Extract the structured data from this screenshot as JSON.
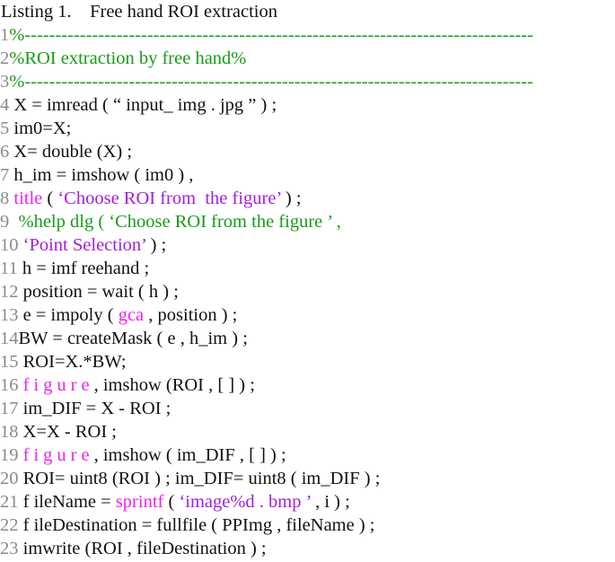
{
  "caption": "Listing 1.    Free hand ROI extraction",
  "colors": {
    "line_number": "#8a8a8a",
    "comment": "#1a9a1a",
    "keyword": "#ee22ee",
    "string": "#a020d8",
    "text": "#111111"
  },
  "lines": [
    {
      "n": "1",
      "parts": [
        {
          "t": "%-----------------------------------------------------------------------------------",
          "c": "cm"
        }
      ]
    },
    {
      "n": "2",
      "parts": [
        {
          "t": "%ROI extraction by free hand%",
          "c": "cm"
        }
      ]
    },
    {
      "n": "3",
      "parts": [
        {
          "t": "%-----------------------------------------------------------------------------------",
          "c": "cm"
        }
      ]
    },
    {
      "n": "4 ",
      "parts": [
        {
          "t": "X = imread ( “ input_ img . jpg ” ) ;",
          "c": ""
        }
      ]
    },
    {
      "n": "5 ",
      "parts": [
        {
          "t": "im0=X;",
          "c": ""
        }
      ]
    },
    {
      "n": "6 ",
      "parts": [
        {
          "t": "X= double (X) ;",
          "c": ""
        }
      ]
    },
    {
      "n": "7 ",
      "parts": [
        {
          "t": "h_im = imshow ( im0 ) ,",
          "c": ""
        }
      ]
    },
    {
      "n": "8 ",
      "parts": [
        {
          "t": "title",
          "c": "kw"
        },
        {
          "t": " ( ",
          "c": ""
        },
        {
          "t": "‘Choose ROI from  the figure’",
          "c": "st"
        },
        {
          "t": " ) ;",
          "c": ""
        }
      ]
    },
    {
      "n": "9  ",
      "parts": [
        {
          "t": "%help dlg ( ‘Choose ROI from the figure ’ ,",
          "c": "cm"
        }
      ]
    },
    {
      "n": "10 ",
      "parts": [
        {
          "t": "‘Point Selection’",
          "c": "st"
        },
        {
          "t": " ) ;",
          "c": ""
        }
      ]
    },
    {
      "n": "11 ",
      "parts": [
        {
          "t": "h = imf reehand ;",
          "c": ""
        }
      ]
    },
    {
      "n": "12 ",
      "parts": [
        {
          "t": "position = wait ( h ) ;",
          "c": ""
        }
      ]
    },
    {
      "n": "13 ",
      "parts": [
        {
          "t": "e = impoly ( ",
          "c": ""
        },
        {
          "t": "gca",
          "c": "kw"
        },
        {
          "t": " , position ) ;",
          "c": ""
        }
      ]
    },
    {
      "n": "14",
      "parts": [
        {
          "t": "BW = createMask ( e , h_im ) ;",
          "c": ""
        }
      ]
    },
    {
      "n": "15 ",
      "parts": [
        {
          "t": "ROI=X.*BW;",
          "c": ""
        }
      ]
    },
    {
      "n": "16 ",
      "parts": [
        {
          "t": "figure",
          "c": "kw sp"
        },
        {
          "t": ", imshow (ROI , [ ] ) ;",
          "c": ""
        }
      ]
    },
    {
      "n": "17 ",
      "parts": [
        {
          "t": "im_DIF = X - ROI ;",
          "c": ""
        }
      ]
    },
    {
      "n": "18 ",
      "parts": [
        {
          "t": "X=X - ROI ;",
          "c": ""
        }
      ]
    },
    {
      "n": "19 ",
      "parts": [
        {
          "t": "figure",
          "c": "kw sp"
        },
        {
          "t": ", imshow ( im_DIF , [ ] ) ;",
          "c": ""
        }
      ]
    },
    {
      "n": "20 ",
      "parts": [
        {
          "t": "ROI= uint8 (ROI ) ; im_DIF= uint8 ( im_DIF ) ;",
          "c": ""
        }
      ]
    },
    {
      "n": "21 ",
      "parts": [
        {
          "t": "f ileName = ",
          "c": ""
        },
        {
          "t": "sprintf",
          "c": "kw"
        },
        {
          "t": " ( ",
          "c": ""
        },
        {
          "t": "‘image%d . bmp ’",
          "c": "st"
        },
        {
          "t": " , i ) ;",
          "c": ""
        }
      ]
    },
    {
      "n": "22 ",
      "parts": [
        {
          "t": "f ileDestination = fullfile ( PPImg , fileName ) ;",
          "c": ""
        }
      ]
    },
    {
      "n": "23 ",
      "parts": [
        {
          "t": "imwrite (ROI , fileDestination ) ;",
          "c": ""
        }
      ]
    }
  ]
}
